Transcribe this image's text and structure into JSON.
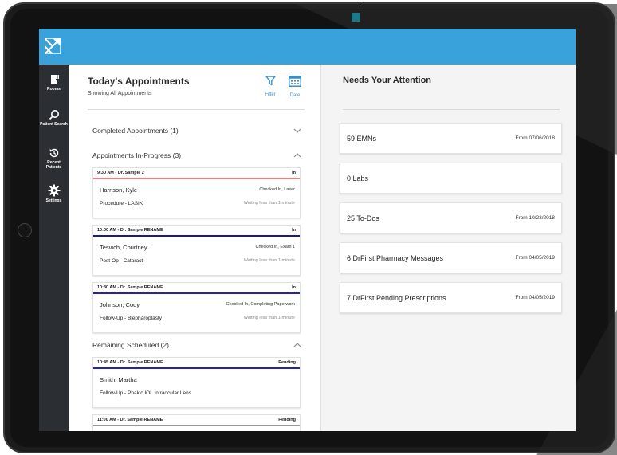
{
  "nav": {
    "items": [
      {
        "label": "Rooms",
        "icon": "door-icon"
      },
      {
        "label": "Patient Search",
        "icon": "search-icon"
      },
      {
        "label": "Recent Patients",
        "icon": "history-icon"
      },
      {
        "label": "Settings",
        "icon": "gear-icon"
      }
    ]
  },
  "appointments": {
    "title": "Today's Appointments",
    "subtitle": "Showing All Appointments",
    "filter_label": "Filter",
    "date_label": "Date",
    "sections": {
      "completed": "Completed Appointments (1)",
      "in_progress": "Appointments In-Progress (3)",
      "remaining": "Remaining Scheduled (2)"
    },
    "cards": [
      {
        "time": "9:30 AM - Dr. Sample 2",
        "status": "In",
        "patient": "Harrison, Kyle",
        "check": "Checked In, Laser",
        "procedure": "Procedure - LASIK",
        "wait": "Waiting less than 1 minute",
        "color": "#e97f84"
      },
      {
        "time": "10:00 AM - Dr. Sample RENAME",
        "status": "In",
        "patient": "Tesvich, Courtney",
        "check": "Checked In, Exam 1",
        "procedure": "Post-Op - Cataract",
        "wait": "Waiting less than 1 minute",
        "color": "#1b1a8c"
      },
      {
        "time": "10:30 AM - Dr. Sample RENAME",
        "status": "In",
        "patient": "Johnson, Cody",
        "check": "Checked In, Completing Paperwork",
        "procedure": "Follow-Up - Blepharoplasty",
        "wait": "Waiting less than 1 minute",
        "color": "#2222b8"
      },
      {
        "time": "10:45 AM - Dr. Sample RENAME",
        "status": "Pending",
        "patient": "Smith, Martha",
        "procedure": "Follow-Up - Phakic IOL Intraocular Lens",
        "color": "#2222b8"
      },
      {
        "time": "11:00 AM - Dr. Sample RENAME",
        "status": "Pending",
        "color": "#9a9a9a"
      }
    ]
  },
  "attention": {
    "title": "Needs Your Attention",
    "items": [
      {
        "label": "59 EMNs",
        "date": "From 07/06/2018"
      },
      {
        "label": "0 Labs",
        "date": ""
      },
      {
        "label": "25 To-Dos",
        "date": "From 10/23/2018"
      },
      {
        "label": "6 DrFirst Pharmacy Messages",
        "date": "From 04/05/2019"
      },
      {
        "label": "7 DrFirst Pending Prescriptions",
        "date": "From 04/05/2019"
      }
    ]
  },
  "colors": {
    "topbar": "#3aa2da",
    "sidebar": "#2b2f33",
    "accent": "#3a8fc9"
  }
}
